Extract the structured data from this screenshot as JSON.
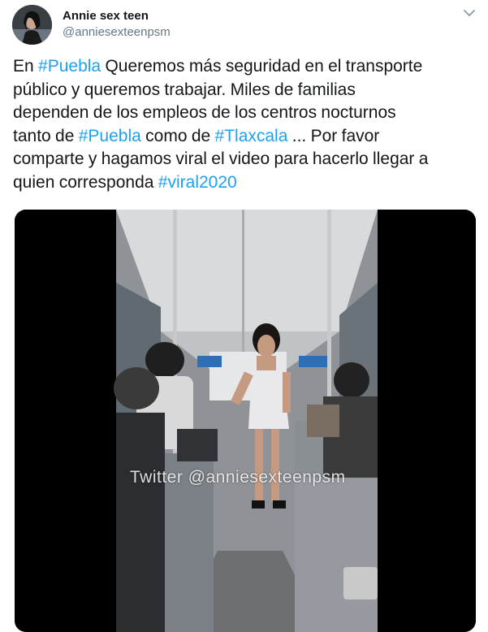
{
  "tweet": {
    "author": {
      "display_name": "Annie sex teen",
      "handle": "@anniesexteenpsm"
    },
    "menu_icon": "chevron-down-icon",
    "text_lines": [
      [
        {
          "t": "En ",
          "tag": false
        },
        {
          "t": "#Puebla",
          "tag": true
        },
        {
          "t": " Queremos más seguridad en el transporte",
          "tag": false
        }
      ],
      [
        {
          "t": "público y queremos trabajar. Miles de familias",
          "tag": false
        }
      ],
      [
        {
          "t": "dependen de los empleos de los centros nocturnos",
          "tag": false
        }
      ],
      [
        {
          "t": "tanto de ",
          "tag": false
        },
        {
          "t": "#Puebla",
          "tag": true
        },
        {
          "t": " como de ",
          "tag": false
        },
        {
          "t": "#Tlaxcala",
          "tag": true
        },
        {
          "t": " ... Por favor",
          "tag": false
        }
      ],
      [
        {
          "t": "comparte y hagamos viral el video para hacerlo llegar a",
          "tag": false
        }
      ],
      [
        {
          "t": "quien corresponda ",
          "tag": false
        },
        {
          "t": "#viral2020",
          "tag": true
        }
      ]
    ],
    "media": {
      "type": "video",
      "watermark": "Twitter @anniesexteenpsm"
    },
    "colors": {
      "link": "#1da1f2",
      "text": "#14171a",
      "secondary": "#657786"
    }
  }
}
